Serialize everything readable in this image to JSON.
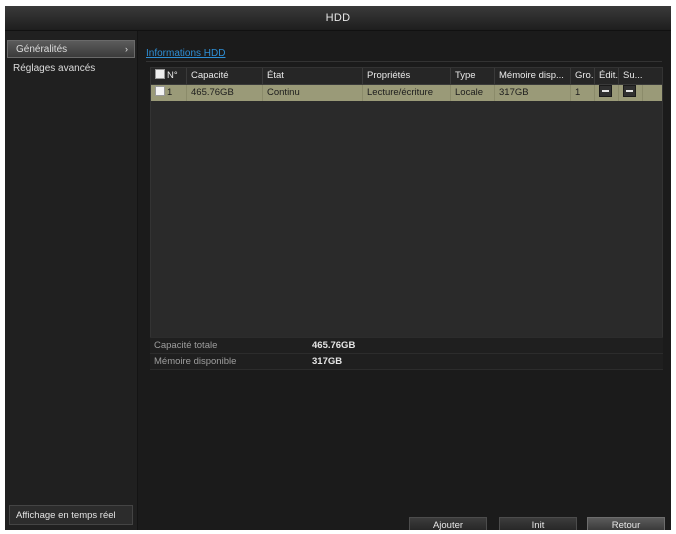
{
  "window": {
    "title": "HDD"
  },
  "sidebar": {
    "items": [
      {
        "label": "Généralités",
        "active": true,
        "arrow": "›"
      },
      {
        "label": "Réglages avancés",
        "active": false
      }
    ],
    "live_view_label": "Affichage en temps réel"
  },
  "main": {
    "section_tab": "Informations HDD",
    "table": {
      "headers": [
        "N°",
        "Capacité",
        "État",
        "Propriétés",
        "Type",
        "Mémoire disp...",
        "Gro...",
        "Édit...",
        "Su..."
      ],
      "rows": [
        {
          "no": "1",
          "capacity": "465.76GB",
          "status": "Continu",
          "properties": "Lecture/écriture",
          "type": "Locale",
          "free_space": "317GB",
          "group": "1"
        }
      ]
    },
    "summary": {
      "total_capacity_label": "Capacité totale",
      "total_capacity_value": "465.76GB",
      "free_space_label": "Mémoire disponible",
      "free_space_value": "317GB"
    },
    "buttons": {
      "add": "Ajouter",
      "init": "Init",
      "back": "Retour"
    }
  },
  "colors": {
    "selected_row": "#9a9a78",
    "link": "#2e8fd6",
    "background": "#1b1b1b"
  }
}
